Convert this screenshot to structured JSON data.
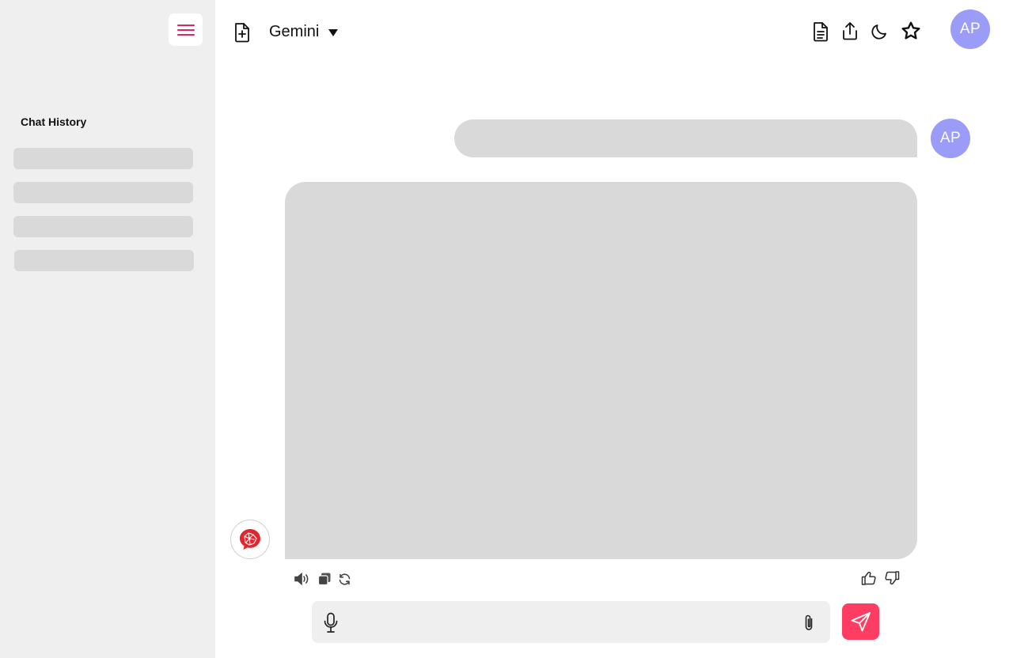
{
  "sidebar": {
    "history_title": "Chat History",
    "history_item_count": 4
  },
  "header": {
    "model_name": "Gemini",
    "user_initials": "AP"
  },
  "conversation": {
    "user_initials": "AP",
    "user_message": "",
    "bot_message": ""
  },
  "composer": {
    "value": "",
    "placeholder": ""
  },
  "colors": {
    "accent": "#ff3d63",
    "menu_icon": "#e0245e",
    "avatar": "#9a9cf7",
    "sidebar_bg": "#efefef",
    "placeholder_block": "#d9d9d9"
  },
  "icons": {
    "menu": "hamburger-icon",
    "new_chat": "new-document-icon",
    "dropdown": "caret-down-icon",
    "document": "document-icon",
    "share": "share-icon",
    "theme": "moon-icon",
    "favorite": "star-icon",
    "speaker": "speaker-icon",
    "copy": "copy-icon",
    "regenerate": "refresh-icon",
    "like": "thumbs-up-icon",
    "dislike": "thumbs-down-icon",
    "mic": "microphone-icon",
    "attach": "paperclip-icon",
    "send": "send-icon",
    "bot": "bot-logo-icon"
  }
}
